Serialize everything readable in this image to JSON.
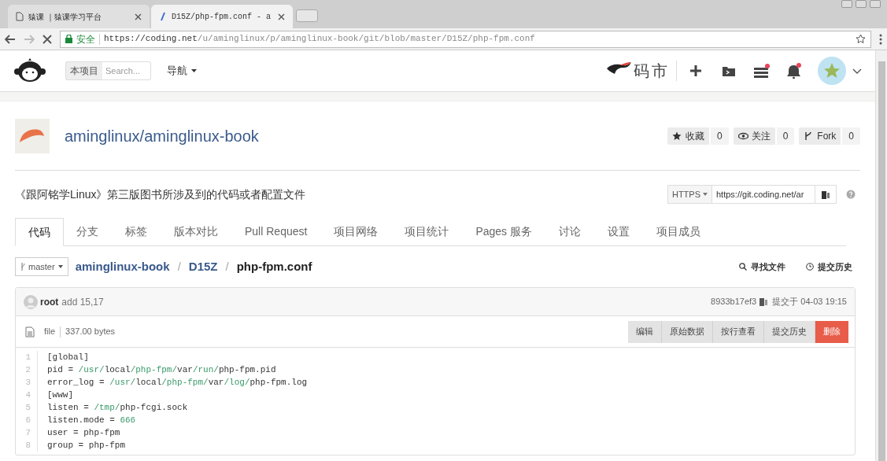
{
  "browser": {
    "tabs": [
      {
        "title": "猿课 ｜猿课学习平台",
        "selected": false
      },
      {
        "title": "D15Z/php-fpm.conf - a",
        "selected": true
      }
    ],
    "address": {
      "secure_label": "安全",
      "url_host": "https://coding.net",
      "url_path": "/u/aminglinux/p/aminglinux-book/git/blob/master/D15Z/php-fpm.conf"
    }
  },
  "header": {
    "scope": "本项目",
    "search_placeholder": "Search...",
    "nav": "导航",
    "logo_text": "码市"
  },
  "repo": {
    "name": "aminglinux/aminglinux-book",
    "actions": [
      {
        "kind": "star",
        "label": "收藏",
        "count": "0"
      },
      {
        "kind": "eye",
        "label": "关注",
        "count": "0"
      },
      {
        "kind": "fork",
        "label": "Fork",
        "count": "0"
      }
    ],
    "description": "《跟阿铭学Linux》第三版图书所涉及到的代码或者配置文件",
    "clone_protocol": "HTTPS",
    "clone_url": "https://git.coding.net/ar"
  },
  "tabs": [
    {
      "label": "代码",
      "selected": true
    },
    {
      "label": "分支",
      "selected": false
    },
    {
      "label": "标签",
      "selected": false
    },
    {
      "label": "版本对比",
      "selected": false
    },
    {
      "label": "Pull Request",
      "selected": false
    },
    {
      "label": "项目网络",
      "selected": false
    },
    {
      "label": "项目统计",
      "selected": false
    },
    {
      "label": "Pages 服务",
      "selected": false
    },
    {
      "label": "讨论",
      "selected": false
    },
    {
      "label": "设置",
      "selected": false
    },
    {
      "label": "项目成员",
      "selected": false
    }
  ],
  "breadcrumb": {
    "branch": "master",
    "separator": "/",
    "parts": [
      "aminglinux-book",
      "D15Z"
    ],
    "file": "php-fpm.conf",
    "actions": [
      {
        "kind": "search",
        "label": "寻找文件"
      },
      {
        "kind": "history",
        "label": "提交历史"
      }
    ]
  },
  "commit": {
    "author": "root",
    "message": "add 15,17",
    "hash": "8933b17ef3",
    "time": "提交于 04-03 19:15"
  },
  "file": {
    "type": "file",
    "size": "337.00 bytes",
    "buttons": [
      {
        "label": "编辑",
        "kind": "normal"
      },
      {
        "label": "原始数据",
        "kind": "normal"
      },
      {
        "label": "按行查看",
        "kind": "normal"
      },
      {
        "label": "提交历史",
        "kind": "normal"
      },
      {
        "label": "删除",
        "kind": "danger"
      }
    ],
    "lines": [
      {
        "number": "1",
        "tokens": [
          {
            "text": "[global]",
            "kind": "plain"
          }
        ]
      },
      {
        "number": "2",
        "tokens": [
          {
            "text": "pid = ",
            "kind": "plain"
          },
          {
            "text": "/usr/",
            "kind": "path"
          },
          {
            "text": "local",
            "kind": "plain"
          },
          {
            "text": "/php-fpm/",
            "kind": "path"
          },
          {
            "text": "var",
            "kind": "plain"
          },
          {
            "text": "/run/",
            "kind": "path"
          },
          {
            "text": "php-fpm.pid",
            "kind": "plain"
          }
        ]
      },
      {
        "number": "3",
        "tokens": [
          {
            "text": "error_log = ",
            "kind": "plain"
          },
          {
            "text": "/usr/",
            "kind": "path"
          },
          {
            "text": "local",
            "kind": "plain"
          },
          {
            "text": "/php-fpm/",
            "kind": "path"
          },
          {
            "text": "var",
            "kind": "plain"
          },
          {
            "text": "/log/",
            "kind": "path"
          },
          {
            "text": "php-fpm.log",
            "kind": "plain"
          }
        ]
      },
      {
        "number": "4",
        "tokens": [
          {
            "text": "[www]",
            "kind": "plain"
          }
        ]
      },
      {
        "number": "5",
        "tokens": [
          {
            "text": "listen = ",
            "kind": "plain"
          },
          {
            "text": "/tmp/",
            "kind": "path"
          },
          {
            "text": "php-fcgi.sock",
            "kind": "plain"
          }
        ]
      },
      {
        "number": "6",
        "tokens": [
          {
            "text": "listen.mode = ",
            "kind": "plain"
          },
          {
            "text": "666",
            "kind": "path"
          }
        ]
      },
      {
        "number": "7",
        "tokens": [
          {
            "text": "user = php-fpm",
            "kind": "plain"
          }
        ]
      },
      {
        "number": "8",
        "tokens": [
          {
            "text": "group = php-fpm",
            "kind": "plain"
          }
        ]
      }
    ]
  }
}
